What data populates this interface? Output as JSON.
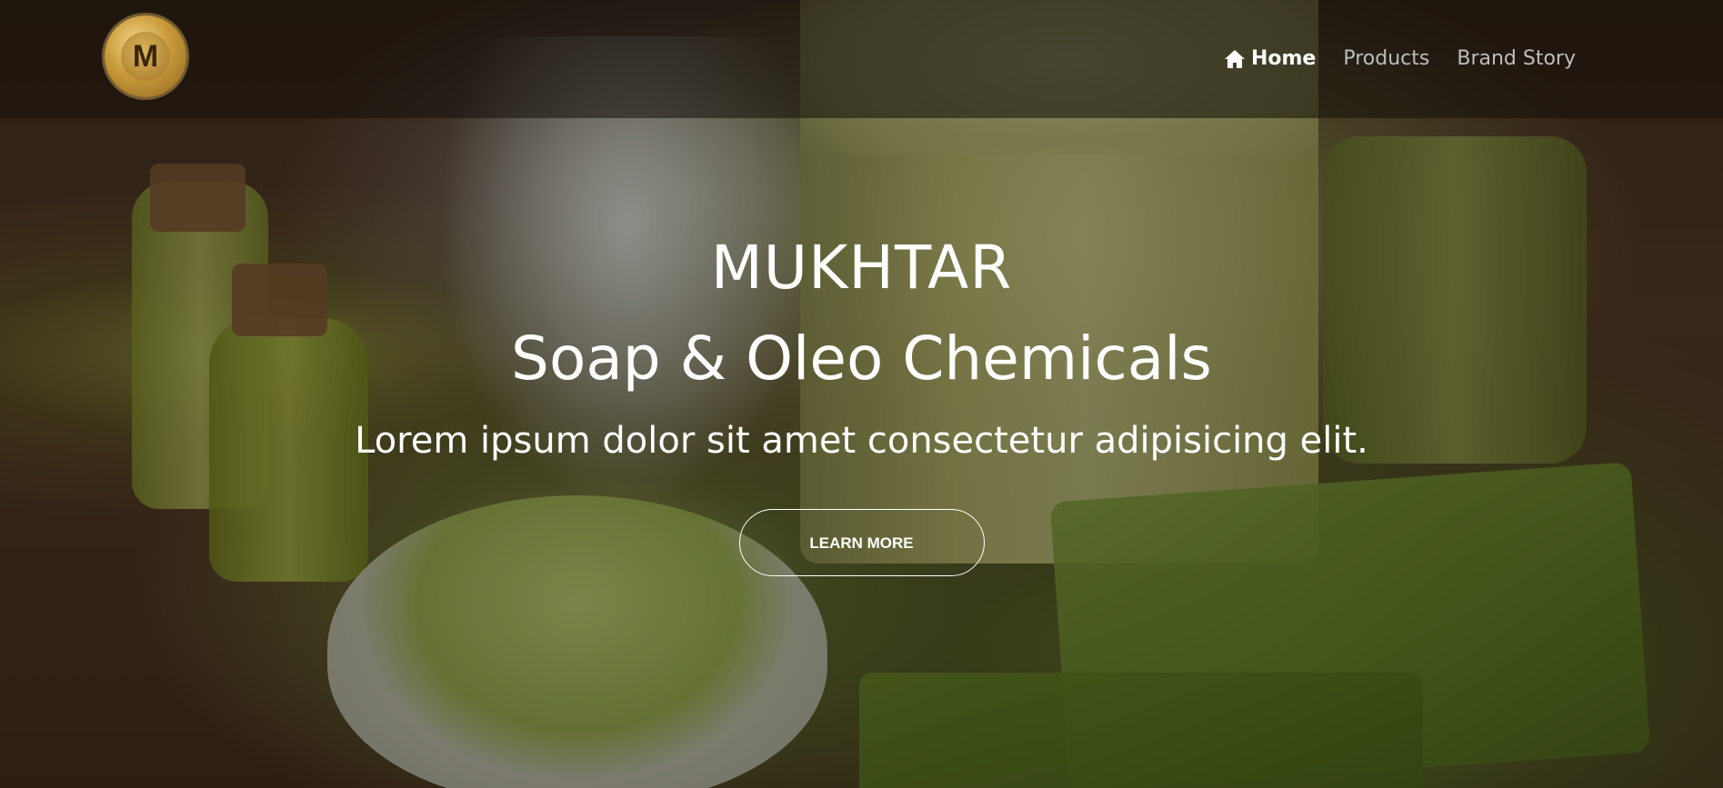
{
  "navbar": {
    "logo_letter": "M",
    "items": [
      {
        "label": "Home",
        "icon": "home-icon",
        "active": true
      },
      {
        "label": "Products",
        "active": false
      },
      {
        "label": "Brand Story",
        "active": false
      }
    ]
  },
  "hero": {
    "brand": "MUKHTAR",
    "title": "Soap & Oleo Chemicals",
    "subtitle": "Lorem ipsum dolor sit amet consectetur adipisicing elit.",
    "cta_label": "LEARN MORE"
  },
  "colors": {
    "nav_active": "#ffffff",
    "nav_inactive": "#bdbdbd",
    "logo_gold": "#c99a3a"
  }
}
